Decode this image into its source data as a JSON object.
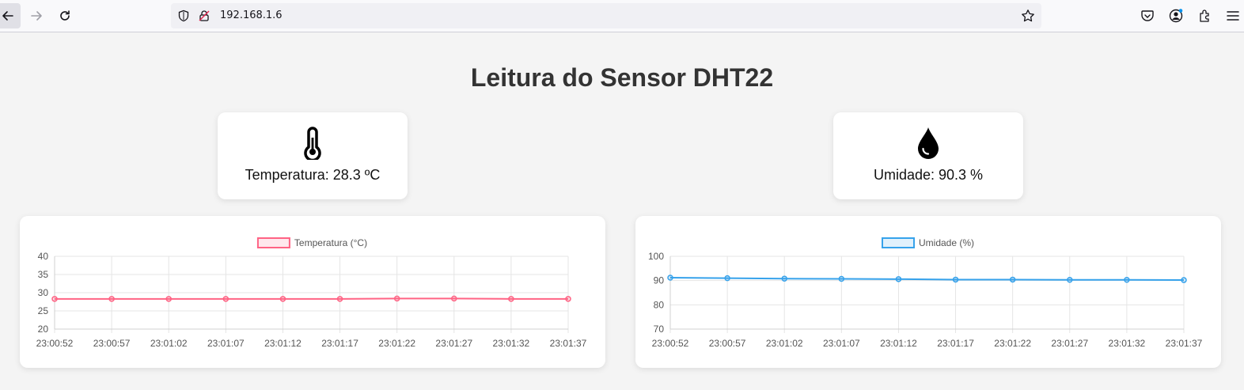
{
  "browser": {
    "url": "192.168.1.6",
    "icons": [
      "back-arrow-icon",
      "forward-arrow-icon",
      "reload-icon",
      "shield-icon",
      "insecure-lock-icon",
      "star-icon",
      "pocket-icon",
      "account-icon",
      "extensions-icon",
      "menu-icon"
    ]
  },
  "page": {
    "title": "Leitura do Sensor DHT22"
  },
  "sensors": {
    "temperature": {
      "label": "Temperatura: 28.3 ºC",
      "icon": "thermometer-icon"
    },
    "humidity": {
      "label": "Umidade: 90.3 %",
      "icon": "water-drop-icon"
    }
  },
  "chart_data": [
    {
      "type": "line",
      "legend": "Temperatura (°C)",
      "color": "#ff6384",
      "x": [
        "23:00:52",
        "23:00:57",
        "23:01:02",
        "23:01:07",
        "23:01:12",
        "23:01:17",
        "23:01:22",
        "23:01:27",
        "23:01:32",
        "23:01:37"
      ],
      "series": [
        {
          "name": "Temperatura (°C)",
          "values": [
            28.3,
            28.3,
            28.3,
            28.3,
            28.3,
            28.3,
            28.4,
            28.4,
            28.3,
            28.3
          ]
        }
      ],
      "ylim": [
        20,
        40
      ],
      "yticks": [
        "20",
        "25",
        "30",
        "35",
        "40"
      ],
      "legend_position": "top"
    },
    {
      "type": "line",
      "legend": "Umidade (%)",
      "color": "#36a2eb",
      "x": [
        "23:00:52",
        "23:00:57",
        "23:01:02",
        "23:01:07",
        "23:01:12",
        "23:01:17",
        "23:01:22",
        "23:01:27",
        "23:01:32",
        "23:01:37"
      ],
      "series": [
        {
          "name": "Umidade (%)",
          "values": [
            91.2,
            91.0,
            90.8,
            90.7,
            90.6,
            90.4,
            90.4,
            90.3,
            90.3,
            90.2
          ]
        }
      ],
      "ylim": [
        70,
        100
      ],
      "yticks": [
        "70",
        "80",
        "90",
        "100"
      ],
      "legend_position": "top"
    }
  ]
}
